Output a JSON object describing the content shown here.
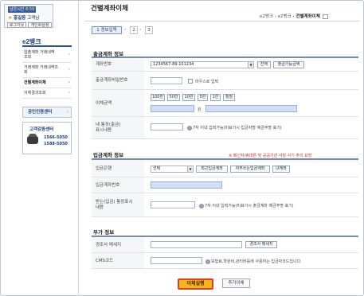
{
  "login": {
    "time_label": "남은시간",
    "time_value": "8:59",
    "user_name": "홍길동",
    "user_suffix": "고객님",
    "logout": "로그아웃",
    "settings": "개인화설정"
  },
  "sidebar": {
    "brand": "e2뱅크",
    "items": [
      {
        "label": "입출계좌 거래내역\n조회"
      },
      {
        "label": "거래계좌 거래내역조\n회"
      },
      {
        "label": "건별계좌이체"
      },
      {
        "label": "이체결과조회"
      }
    ],
    "cert": "공인인증센터",
    "call_title": "고객감동센터",
    "call_numbers": [
      "1566-5050",
      "1588-5050"
    ]
  },
  "header": {
    "title": "건별계좌이체",
    "breadcrumb": [
      "e2뱅크",
      "e2뱅크",
      "건별계좌이체"
    ]
  },
  "steps": [
    "1 정보입력",
    "2",
    "3"
  ],
  "withdraw": {
    "section": "출금계좌 정보",
    "account_label": "계좌번호",
    "account_value": "1234567-89-101234",
    "balance_btn": "잔액",
    "available_btn": "출금가능금액",
    "password_label": "출금계좌비밀번호",
    "mouse_input": "마우스로 입력",
    "amount_label": "이체금액",
    "amount_buttons": [
      "100만",
      "50만",
      "10만",
      "5만",
      "1만",
      "정정"
    ],
    "won": "원",
    "memo_label": "내 통장(출금)\n표시내용",
    "memo_hint": "7자 이내 입력가능(미표기시 입금자명 예금주명 표기)"
  },
  "deposit": {
    "section": "입금계좌 정보",
    "warning": "※ 메신저/휴대폰 및 공공기관 사칭 사기 주의 요망",
    "bank_label": "입금은행",
    "bank_value": "선택",
    "recent_btn": "최근입금계좌",
    "frequent_btn": "자주쓰는입금계좌",
    "my_btn": "내계좌",
    "account_label": "입금계좌번호",
    "memo_label": "받는(입금) 통장표시\n내용",
    "memo_hint": "7자 이내 입력가능(미표기시 출금계좌 예금주명 표기)"
  },
  "extra": {
    "section": "부가 정보",
    "message_label": "경조사 메세지",
    "message_btn": "경조사 메세지",
    "cms_label": "CMS코드",
    "cms_hint": "보험료,학원비,관리비등에 사용하는 입금자코드입니다."
  },
  "actions": {
    "submit": "이체실행",
    "add": "추가이체"
  }
}
